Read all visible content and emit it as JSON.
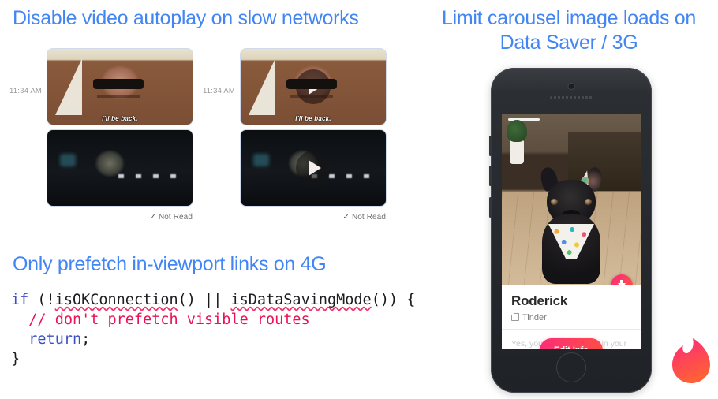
{
  "slide": {
    "titles": {
      "left": "Disable video autoplay on slow networks",
      "right": "Limit carousel image loads on Data Saver / 3G",
      "code_section": "Only prefetch in-viewport links on 4G"
    },
    "accent_color": "#4285f4"
  },
  "chat": {
    "left": {
      "timestamp": "11:34 AM",
      "status": "Not Read",
      "status_tick": "✓",
      "caption": "I'll be back.",
      "has_play_overlay": false
    },
    "right": {
      "timestamp": "11:34 AM",
      "status": "Not Read",
      "status_tick": "✓",
      "caption": "I'll be back.",
      "has_play_overlay": true
    }
  },
  "code": {
    "language": "javascript",
    "lines": [
      {
        "tokens": [
          {
            "t": "if",
            "c": "k"
          },
          {
            "t": " (!",
            "c": "p"
          },
          {
            "t": "isOKConnection",
            "c": "fn"
          },
          {
            "t": "() || ",
            "c": "p"
          },
          {
            "t": "isDataSavingMode",
            "c": "fn"
          },
          {
            "t": "()) {",
            "c": "p"
          }
        ]
      },
      {
        "tokens": [
          {
            "t": "  // don't prefetch visible routes",
            "c": "cm"
          }
        ]
      },
      {
        "tokens": [
          {
            "t": "  ",
            "c": "p"
          },
          {
            "t": "return",
            "c": "k"
          },
          {
            "t": ";",
            "c": "p"
          }
        ]
      },
      {
        "tokens": [
          {
            "t": "}",
            "c": "p"
          }
        ]
      }
    ],
    "colors": {
      "keyword": "#3b4fc4",
      "comment": "#ec1058",
      "punctuation": "#17191c",
      "spellcheck_underline": "#f0336b"
    }
  },
  "phone": {
    "device": "iphone-mockup",
    "card": {
      "name": "Roderick",
      "source_label": "Tinder",
      "source_icon": "briefcase-icon",
      "body_text": "Yes, you can use Tinder in your browser, no app needed.",
      "button_label": "Edit Info",
      "download_badge_icon": "download-arrow-icon",
      "photo_alt": "french-bulldog-with-party-hat"
    }
  },
  "branding": {
    "logo_name": "tinder-flame-logo",
    "logo_gradient_start": "#fd267d",
    "logo_gradient_end": "#ff6036"
  }
}
